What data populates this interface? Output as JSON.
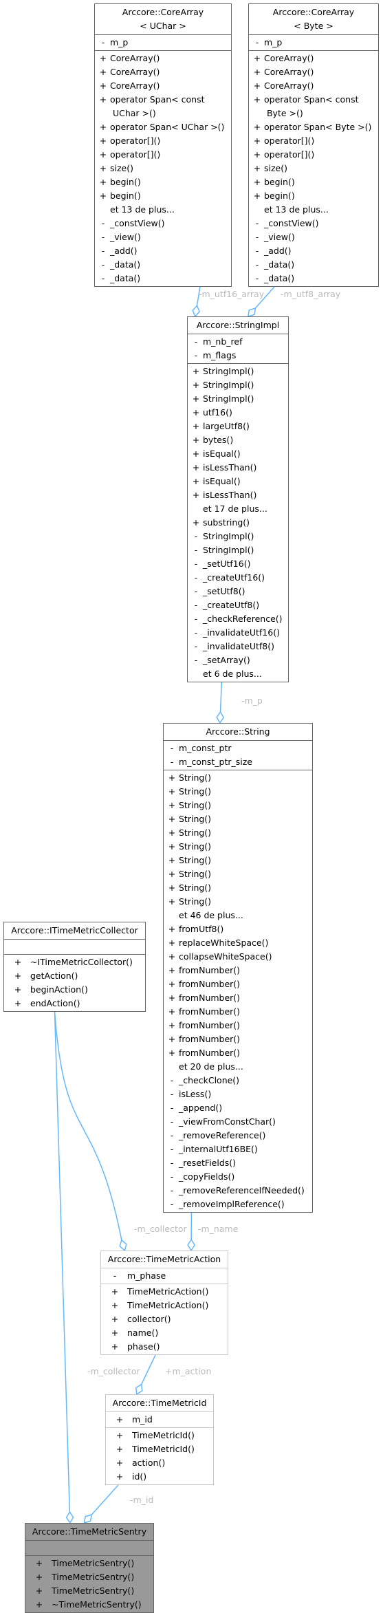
{
  "diagram": {
    "type": "doxygen-collaboration-graph",
    "nodes": [
      {
        "id": "corearray_uchar",
        "title": "Arccore::CoreArray\n< UChar >",
        "attributes": [
          {
            "vis": "-",
            "name": "m_p"
          }
        ],
        "methods": [
          {
            "vis": "+",
            "name": "CoreArray()"
          },
          {
            "vis": "+",
            "name": "CoreArray()"
          },
          {
            "vis": "+",
            "name": "CoreArray()"
          },
          {
            "vis": "+",
            "name": "operator Span< const\n UChar >()"
          },
          {
            "vis": "+",
            "name": "operator Span< UChar >()"
          },
          {
            "vis": "+",
            "name": "operator[]()"
          },
          {
            "vis": "+",
            "name": "operator[]()"
          },
          {
            "vis": "+",
            "name": "size()"
          },
          {
            "vis": "+",
            "name": "begin()"
          },
          {
            "vis": "+",
            "name": "begin()"
          },
          {
            "vis": "",
            "name": "et 13 de plus..."
          },
          {
            "vis": "-",
            "name": "_constView()"
          },
          {
            "vis": "-",
            "name": "_view()"
          },
          {
            "vis": "-",
            "name": "_add()"
          },
          {
            "vis": "-",
            "name": "_data()"
          },
          {
            "vis": "-",
            "name": "_data()"
          }
        ]
      },
      {
        "id": "corearray_byte",
        "title": "Arccore::CoreArray\n< Byte >",
        "attributes": [
          {
            "vis": "-",
            "name": "m_p"
          }
        ],
        "methods": [
          {
            "vis": "+",
            "name": "CoreArray()"
          },
          {
            "vis": "+",
            "name": "CoreArray()"
          },
          {
            "vis": "+",
            "name": "CoreArray()"
          },
          {
            "vis": "+",
            "name": "operator Span< const\n Byte >()"
          },
          {
            "vis": "+",
            "name": "operator Span< Byte >()"
          },
          {
            "vis": "+",
            "name": "operator[]()"
          },
          {
            "vis": "+",
            "name": "operator[]()"
          },
          {
            "vis": "+",
            "name": "size()"
          },
          {
            "vis": "+",
            "name": "begin()"
          },
          {
            "vis": "+",
            "name": "begin()"
          },
          {
            "vis": "",
            "name": "et 13 de plus..."
          },
          {
            "vis": "-",
            "name": "_constView()"
          },
          {
            "vis": "-",
            "name": "_view()"
          },
          {
            "vis": "-",
            "name": "_add()"
          },
          {
            "vis": "-",
            "name": "_data()"
          },
          {
            "vis": "-",
            "name": "_data()"
          }
        ]
      },
      {
        "id": "stringimpl",
        "title": "Arccore::StringImpl",
        "attributes": [
          {
            "vis": "-",
            "name": "m_nb_ref"
          },
          {
            "vis": "-",
            "name": "m_flags"
          }
        ],
        "methods": [
          {
            "vis": "+",
            "name": "StringImpl()"
          },
          {
            "vis": "+",
            "name": "StringImpl()"
          },
          {
            "vis": "+",
            "name": "StringImpl()"
          },
          {
            "vis": "+",
            "name": "utf16()"
          },
          {
            "vis": "+",
            "name": "largeUtf8()"
          },
          {
            "vis": "+",
            "name": "bytes()"
          },
          {
            "vis": "+",
            "name": "isEqual()"
          },
          {
            "vis": "+",
            "name": "isLessThan()"
          },
          {
            "vis": "+",
            "name": "isEqual()"
          },
          {
            "vis": "+",
            "name": "isLessThan()"
          },
          {
            "vis": "",
            "name": "et 17 de plus..."
          },
          {
            "vis": "+",
            "name": "substring()"
          },
          {
            "vis": "-",
            "name": "StringImpl()"
          },
          {
            "vis": "-",
            "name": "StringImpl()"
          },
          {
            "vis": "-",
            "name": "_setUtf16()"
          },
          {
            "vis": "-",
            "name": "_createUtf16()"
          },
          {
            "vis": "-",
            "name": "_setUtf8()"
          },
          {
            "vis": "-",
            "name": "_createUtf8()"
          },
          {
            "vis": "-",
            "name": "_checkReference()"
          },
          {
            "vis": "-",
            "name": "_invalidateUtf16()"
          },
          {
            "vis": "-",
            "name": "_invalidateUtf8()"
          },
          {
            "vis": "-",
            "name": "_setArray()"
          },
          {
            "vis": "",
            "name": "et 6 de plus..."
          }
        ]
      },
      {
        "id": "string",
        "title": "Arccore::String",
        "attributes": [
          {
            "vis": "-",
            "name": "m_const_ptr"
          },
          {
            "vis": "-",
            "name": "m_const_ptr_size"
          }
        ],
        "methods": [
          {
            "vis": "+",
            "name": "String()"
          },
          {
            "vis": "+",
            "name": "String()"
          },
          {
            "vis": "+",
            "name": "String()"
          },
          {
            "vis": "+",
            "name": "String()"
          },
          {
            "vis": "+",
            "name": "String()"
          },
          {
            "vis": "+",
            "name": "String()"
          },
          {
            "vis": "+",
            "name": "String()"
          },
          {
            "vis": "+",
            "name": "String()"
          },
          {
            "vis": "+",
            "name": "String()"
          },
          {
            "vis": "+",
            "name": "String()"
          },
          {
            "vis": "",
            "name": "et 46 de plus..."
          },
          {
            "vis": "+",
            "name": "fromUtf8()"
          },
          {
            "vis": "+",
            "name": "replaceWhiteSpace()"
          },
          {
            "vis": "+",
            "name": "collapseWhiteSpace()"
          },
          {
            "vis": "+",
            "name": "fromNumber()"
          },
          {
            "vis": "+",
            "name": "fromNumber()"
          },
          {
            "vis": "+",
            "name": "fromNumber()"
          },
          {
            "vis": "+",
            "name": "fromNumber()"
          },
          {
            "vis": "+",
            "name": "fromNumber()"
          },
          {
            "vis": "+",
            "name": "fromNumber()"
          },
          {
            "vis": "+",
            "name": "fromNumber()"
          },
          {
            "vis": "",
            "name": "et 20 de plus..."
          },
          {
            "vis": "-",
            "name": "_checkClone()"
          },
          {
            "vis": "-",
            "name": "isLess()"
          },
          {
            "vis": "-",
            "name": "_append()"
          },
          {
            "vis": "-",
            "name": "_viewFromConstChar()"
          },
          {
            "vis": "-",
            "name": "_removeReference()"
          },
          {
            "vis": "-",
            "name": "_internalUtf16BE()"
          },
          {
            "vis": "-",
            "name": "_resetFields()"
          },
          {
            "vis": "-",
            "name": "_copyFields()"
          },
          {
            "vis": "-",
            "name": "_removeReferenceIfNeeded()"
          },
          {
            "vis": "-",
            "name": "_removeImplReference()"
          }
        ]
      },
      {
        "id": "itimemetriccollector",
        "title": "Arccore::ITimeMetricCollector",
        "attributes": [],
        "methods": [
          {
            "vis": "+",
            "name": "~ITimeMetricCollector()"
          },
          {
            "vis": "+",
            "name": "getAction()"
          },
          {
            "vis": "+",
            "name": "beginAction()"
          },
          {
            "vis": "+",
            "name": "endAction()"
          }
        ]
      },
      {
        "id": "timemetricaction",
        "title": "Arccore::TimeMetricAction",
        "attributes": [
          {
            "vis": "-",
            "name": "m_phase"
          }
        ],
        "methods": [
          {
            "vis": "+",
            "name": "TimeMetricAction()"
          },
          {
            "vis": "+",
            "name": "TimeMetricAction()"
          },
          {
            "vis": "+",
            "name": "collector()"
          },
          {
            "vis": "+",
            "name": "name()"
          },
          {
            "vis": "+",
            "name": "phase()"
          }
        ]
      },
      {
        "id": "timemetricid",
        "title": "Arccore::TimeMetricId",
        "attributes": [
          {
            "vis": "+",
            "name": "m_id"
          }
        ],
        "methods": [
          {
            "vis": "+",
            "name": "TimeMetricId()"
          },
          {
            "vis": "+",
            "name": "TimeMetricId()"
          },
          {
            "vis": "+",
            "name": "action()"
          },
          {
            "vis": "+",
            "name": "id()"
          }
        ]
      },
      {
        "id": "timemetricsentry",
        "title": "Arccore::TimeMetricSentry",
        "attributes": [],
        "methods": [
          {
            "vis": "+",
            "name": "TimeMetricSentry()"
          },
          {
            "vis": "+",
            "name": "TimeMetricSentry()"
          },
          {
            "vis": "+",
            "name": "TimeMetricSentry()"
          },
          {
            "vis": "+",
            "name": "~TimeMetricSentry()"
          }
        ]
      }
    ],
    "edges": [
      {
        "from": "corearray_uchar",
        "to": "stringimpl",
        "label": "-m_utf16_array"
      },
      {
        "from": "corearray_byte",
        "to": "stringimpl",
        "label": "-m_utf8_array"
      },
      {
        "from": "stringimpl",
        "to": "string",
        "label": "-m_p"
      },
      {
        "from": "itimemetriccollector",
        "to": "timemetricaction",
        "label": "-m_collector"
      },
      {
        "from": "string",
        "to": "timemetricaction",
        "label": "-m_name"
      },
      {
        "from": "timemetricaction",
        "to": "timemetricid",
        "label": "+m_action"
      },
      {
        "from": "itimemetriccollector",
        "to": "timemetricsentry",
        "label": "-m_collector"
      },
      {
        "from": "timemetricid",
        "to": "timemetricsentry",
        "label": "-m_id"
      }
    ],
    "colors": {
      "edge": "#63b8ff",
      "edge_label": "#bbbbbb",
      "border_dark": "#666666",
      "border_light": "#c8c8c8",
      "focus_fill": "#999999"
    }
  }
}
